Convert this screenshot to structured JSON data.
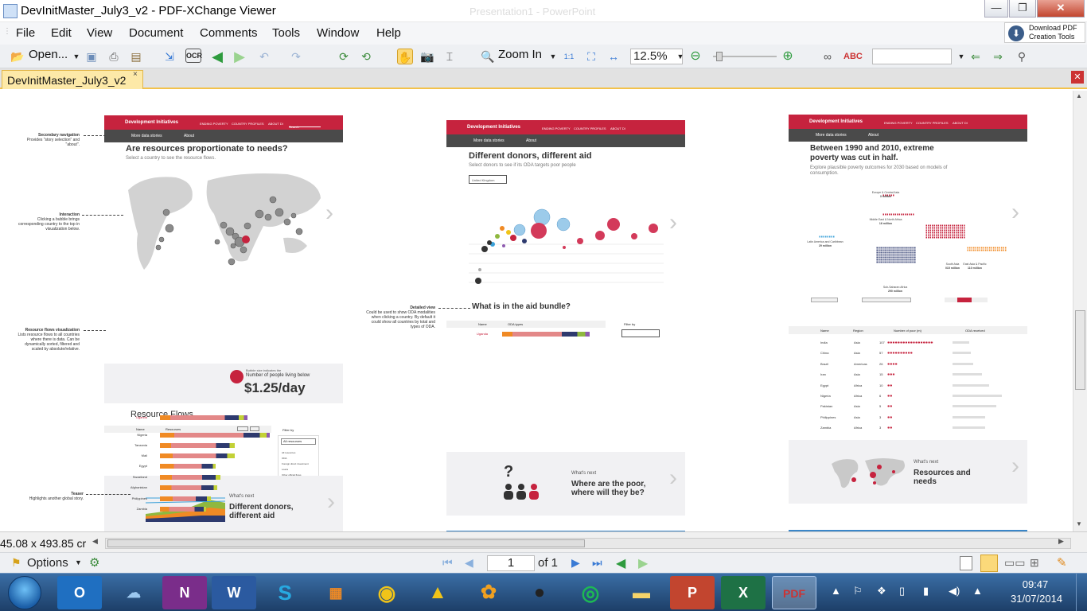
{
  "window": {
    "title": "DevInitMaster_July3_v2 - PDF-XChange Viewer",
    "background_title": "Presentation1 - PowerPoint",
    "min_label": "—",
    "max_label": "❐",
    "close_label": "✕"
  },
  "menu": [
    "File",
    "Edit",
    "View",
    "Document",
    "Comments",
    "Tools",
    "Window",
    "Help"
  ],
  "download_pdf": {
    "line1": "Download PDF",
    "line2": "Creation Tools"
  },
  "toolbar": {
    "open_label": "Open...",
    "ocr_label": "OCR",
    "zoom_in_label": "Zoom In",
    "zoom_value": "12.5%",
    "one_to_one": "1:1"
  },
  "tab": {
    "label": "DevInitMaster_July3_v2",
    "close": "×"
  },
  "slides": {
    "s1": {
      "logo": "Development Initiatives",
      "nav": [
        "ENDING POVERTY",
        "COUNTRY PROFILES",
        "ABOUT DI"
      ],
      "search": "Search",
      "more": "More data stories",
      "about": "About",
      "title": "Are resources proportionate to needs?",
      "subtitle": "Select a country to see the resource flows.",
      "legend_small": "Bubble size indicates the",
      "legend_label": "Number of people living below",
      "legend_value": "$1.25/day",
      "resource_title": "Resource Flows",
      "col_name": "Name",
      "col_resources": "Resources",
      "filter_by": "Filter by",
      "filter_select": "All resources",
      "filter_items": [
        "All resources",
        "ODA",
        "Foreign direct investment",
        "Loans",
        "Other official flows",
        "Etc"
      ],
      "countries": [
        "Uganda",
        "Nigeria",
        "Tanzania",
        "Mali",
        "Egypt",
        "Swaziland",
        "Afghanistan",
        "Philippines",
        "Zambia"
      ],
      "whats_next": "What's next",
      "teaser": "Different donors, different aid"
    },
    "s2": {
      "title": "Different donors, different aid",
      "subtitle": "Select donors to see if its ODA targets poor people",
      "select": "United Kingdom",
      "bundle": "What is in the aid bundle?",
      "col_name": "Name",
      "col_oda": "ODA types",
      "filter_by": "Filter by",
      "country": "Uganda",
      "whats_next": "What's next",
      "teaser": "Where are the poor, where will they be?"
    },
    "s3": {
      "title": "Between 1990 and 2010, extreme poverty was cut in half.",
      "subtitle": "Explore plausible poverty outcomes for 2030 based on models of consumption.",
      "regions": [
        {
          "name": "Europe & Central Asia",
          "value": "3 million"
        },
        {
          "name": "Middle East & North Africa",
          "value": "16 million"
        },
        {
          "name": "Latin America and Caribbean",
          "value": "29 million"
        },
        {
          "name": "South Asia",
          "value": "015 million"
        },
        {
          "name": "East Asia & Pacific",
          "value": "110 million"
        },
        {
          "name": "Sub-Saharan Africa",
          "value": "290 million"
        }
      ],
      "table_headers": [
        "Name",
        "Region",
        "Number of poor (m)",
        "ODA received"
      ],
      "rows": [
        {
          "name": "India",
          "region": "Asia",
          "n": "107"
        },
        {
          "name": "China",
          "region": "Asia",
          "n": "57"
        },
        {
          "name": "Brazil",
          "region": "Americas",
          "n": "26"
        },
        {
          "name": "Iran",
          "region": "Asia",
          "n": "15"
        },
        {
          "name": "Egypt",
          "region": "Africa",
          "n": "10"
        },
        {
          "name": "Nigeria",
          "region": "Africa",
          "n": "6"
        },
        {
          "name": "Pakistan",
          "region": "Asia",
          "n": "5"
        },
        {
          "name": "Philippines",
          "region": "Asia",
          "n": "3"
        },
        {
          "name": "Zambia",
          "region": "Africa",
          "n": "3"
        }
      ],
      "whats_next": "What's next",
      "teaser": "Resources and needs"
    }
  },
  "annotations": {
    "secondary_nav_title": "Secondary navigation",
    "secondary_nav_text": "Provides \"story selection\" and \"about\".",
    "interaction_title": "Interaction",
    "interaction_text": "Clicking a bubble brings corresponding country to the top in visualization below.",
    "rf_title": "Resource flows visualization",
    "rf_text": "Lists resource flows to all countries where there is data. Can be dynamically sorted, filtered and scaled by absolute/relative.",
    "teaser_title": "Teaser",
    "teaser_text": "Highlights another global story.",
    "detailed_title": "Detailed view",
    "detailed_text": "Could be used to show ODA modalities when clicking a country. By default it could show all countries by total and types of ODA."
  },
  "status": {
    "dims": "45.08 x 493.85 cr",
    "options": "Options",
    "page": "1",
    "of": "of 1"
  },
  "taskbar": {
    "time": "09:47",
    "date": "31/07/2014"
  }
}
